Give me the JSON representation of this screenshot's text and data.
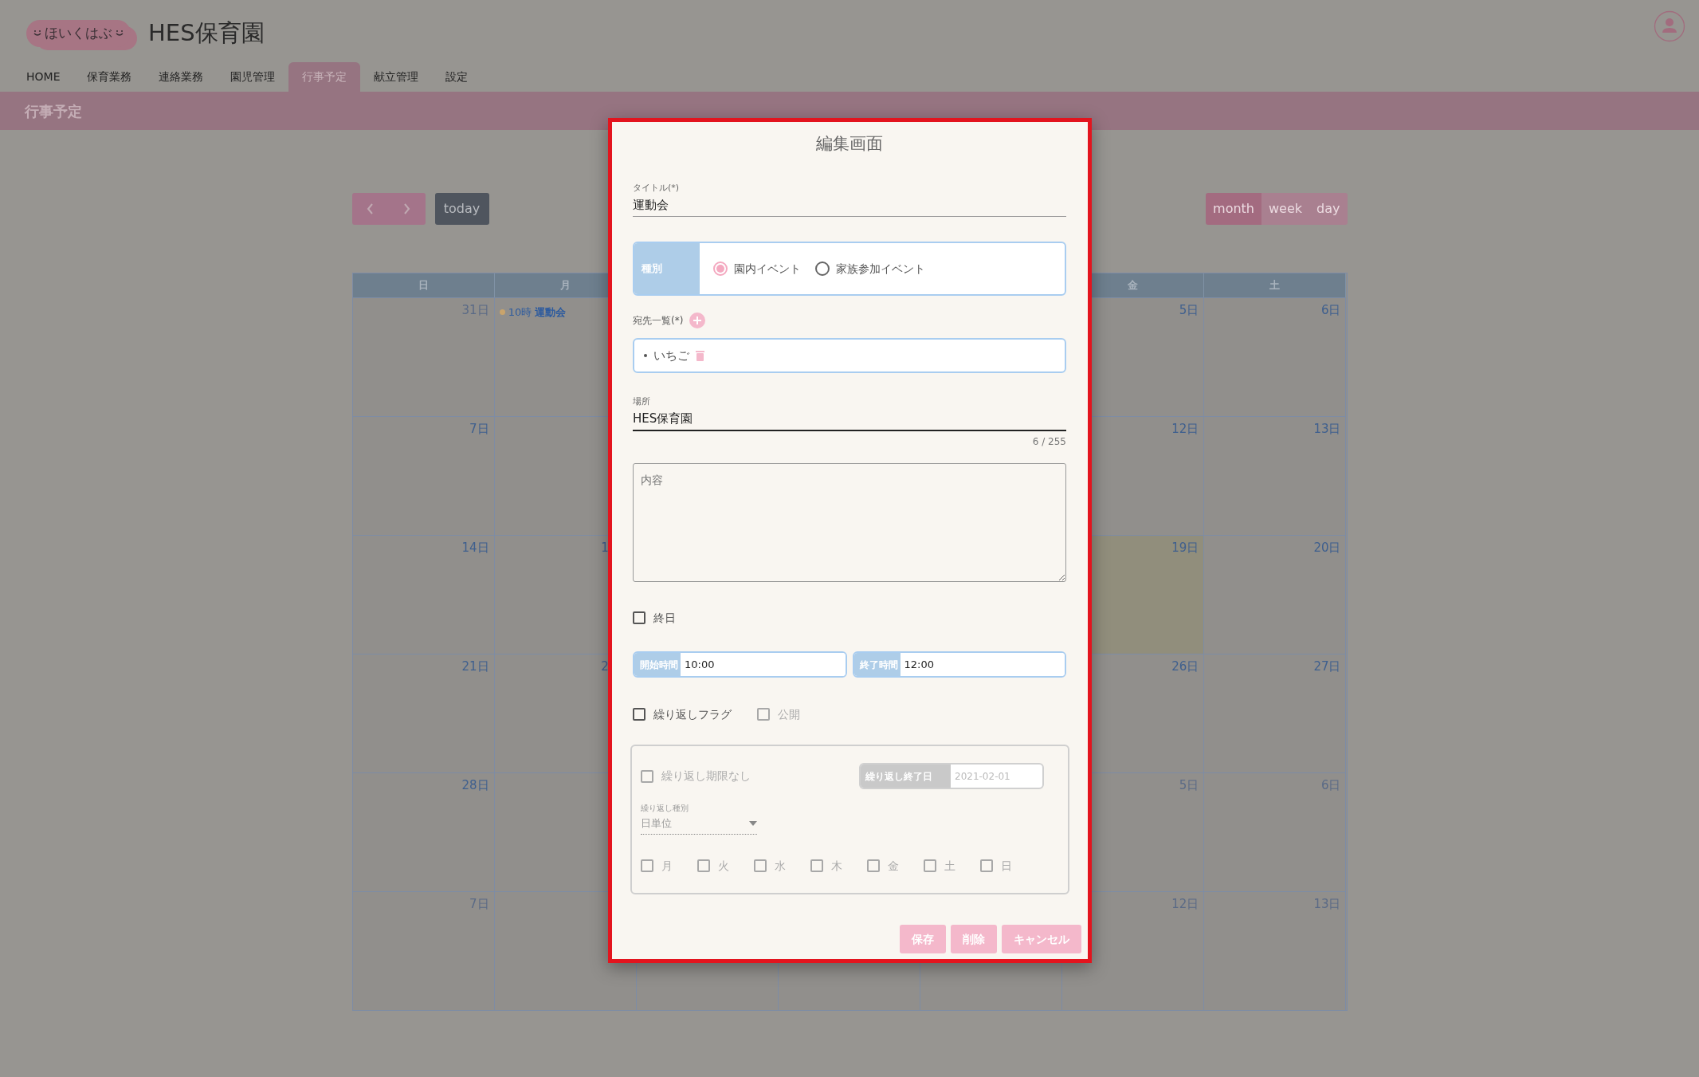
{
  "header": {
    "logo": "ほいくはぶ",
    "title": "HES保育園"
  },
  "nav": [
    {
      "label": "HOME",
      "selected": false
    },
    {
      "label": "保育業務",
      "selected": false
    },
    {
      "label": "連絡業務",
      "selected": false
    },
    {
      "label": "園児管理",
      "selected": false
    },
    {
      "label": "行事予定",
      "selected": true
    },
    {
      "label": "献立管理",
      "selected": false
    },
    {
      "label": "設定",
      "selected": false
    }
  ],
  "page_title": "行事予定",
  "toolbar": {
    "today": "today",
    "views": [
      {
        "label": "month",
        "selected": true
      },
      {
        "label": "week",
        "selected": false
      },
      {
        "label": "day",
        "selected": false
      }
    ]
  },
  "calendar": {
    "weekdays_left": [
      {
        "label": "日"
      },
      {
        "label": "月"
      }
    ],
    "weekdays_right": [
      {
        "label": "金"
      },
      {
        "label": "土"
      }
    ],
    "weeks": [
      {
        "cells": [
          {
            "day": "31日",
            "other_month": true,
            "today": false
          },
          {
            "today": false,
            "events": [
              {
                "time": "10時",
                "title": "運動会"
              }
            ]
          },
          {},
          {},
          {},
          {
            "day": "5日",
            "other_month": false,
            "today": false
          },
          {
            "day": "6日",
            "other_month": false,
            "today": false
          }
        ]
      },
      {
        "cells": [
          {
            "day": "7日",
            "other_month": false,
            "today": false
          },
          {
            "today": false
          },
          {},
          {},
          {},
          {
            "day": "12日",
            "other_month": false,
            "today": false
          },
          {
            "day": "13日",
            "other_month": false,
            "today": false
          }
        ]
      },
      {
        "cells": [
          {
            "day": "14日",
            "other_month": false,
            "today": false
          },
          {
            "day": "1",
            "cut": true,
            "other_month": false,
            "today": false
          },
          {},
          {},
          {},
          {
            "day": "19日",
            "other_month": false,
            "today": true
          },
          {
            "day": "20日",
            "other_month": false,
            "today": false
          }
        ]
      },
      {
        "cells": [
          {
            "day": "21日",
            "other_month": false,
            "today": false
          },
          {
            "day": "2",
            "cut": true,
            "other_month": false,
            "today": false
          },
          {},
          {},
          {},
          {
            "day": "26日",
            "other_month": false,
            "today": false
          },
          {
            "day": "27日",
            "other_month": false,
            "today": false
          }
        ]
      },
      {
        "cells": [
          {
            "day": "28日",
            "other_month": false,
            "today": false
          },
          {
            "today": false
          },
          {},
          {},
          {},
          {
            "day": "5日",
            "other_month": true,
            "today": false
          },
          {
            "day": "6日",
            "other_month": true,
            "today": false
          }
        ]
      },
      {
        "cells": [
          {
            "day": "7日",
            "other_month": true,
            "today": false
          },
          {
            "today": false
          },
          {
            "today": false
          },
          {
            "today": false
          },
          {
            "today": false
          },
          {
            "day": "12日",
            "other_month": true,
            "today": false
          },
          {
            "day": "13日",
            "other_month": true,
            "today": false
          }
        ]
      }
    ]
  },
  "dialog": {
    "title": "編集画面",
    "title_field": {
      "label": "タイトル(*)",
      "value": "運動会"
    },
    "type_group": {
      "label": "種別",
      "options": [
        {
          "label": "園内イベント",
          "selected": true
        },
        {
          "label": "家族参加イベント",
          "selected": false
        }
      ]
    },
    "recipients": {
      "label": "宛先一覧(*)",
      "items": [
        {
          "name": "いちご"
        }
      ]
    },
    "place_field": {
      "label": "場所",
      "value": "HES保育園",
      "counter": "6 / 255"
    },
    "content_field": {
      "placeholder": "内容"
    },
    "all_day": {
      "label": "終日",
      "checked": false
    },
    "times": [
      {
        "label": "開始時間",
        "value": "10:00"
      },
      {
        "label": "終了時間",
        "value": "12:00"
      }
    ],
    "flags": [
      {
        "label": "繰り返しフラグ",
        "checked": false,
        "disabled": false
      },
      {
        "label": "公開",
        "checked": false,
        "disabled": true
      }
    ],
    "repeat": {
      "disabled": true,
      "no_limit": {
        "label": "繰り返し期限なし",
        "checked": false
      },
      "end_date": {
        "label": "繰り返し終了日",
        "value": "2021-02-01"
      },
      "type": {
        "label": "繰り返し種別",
        "value": "日単位"
      },
      "weekdays": [
        {
          "label": "月",
          "checked": false
        },
        {
          "label": "火",
          "checked": false
        },
        {
          "label": "水",
          "checked": false
        },
        {
          "label": "木",
          "checked": false
        },
        {
          "label": "金",
          "checked": false
        },
        {
          "label": "土",
          "checked": false
        },
        {
          "label": "日",
          "checked": false
        }
      ]
    },
    "buttons": [
      {
        "label": "保存"
      },
      {
        "label": "削除"
      },
      {
        "label": "キャンセル"
      }
    ]
  }
}
